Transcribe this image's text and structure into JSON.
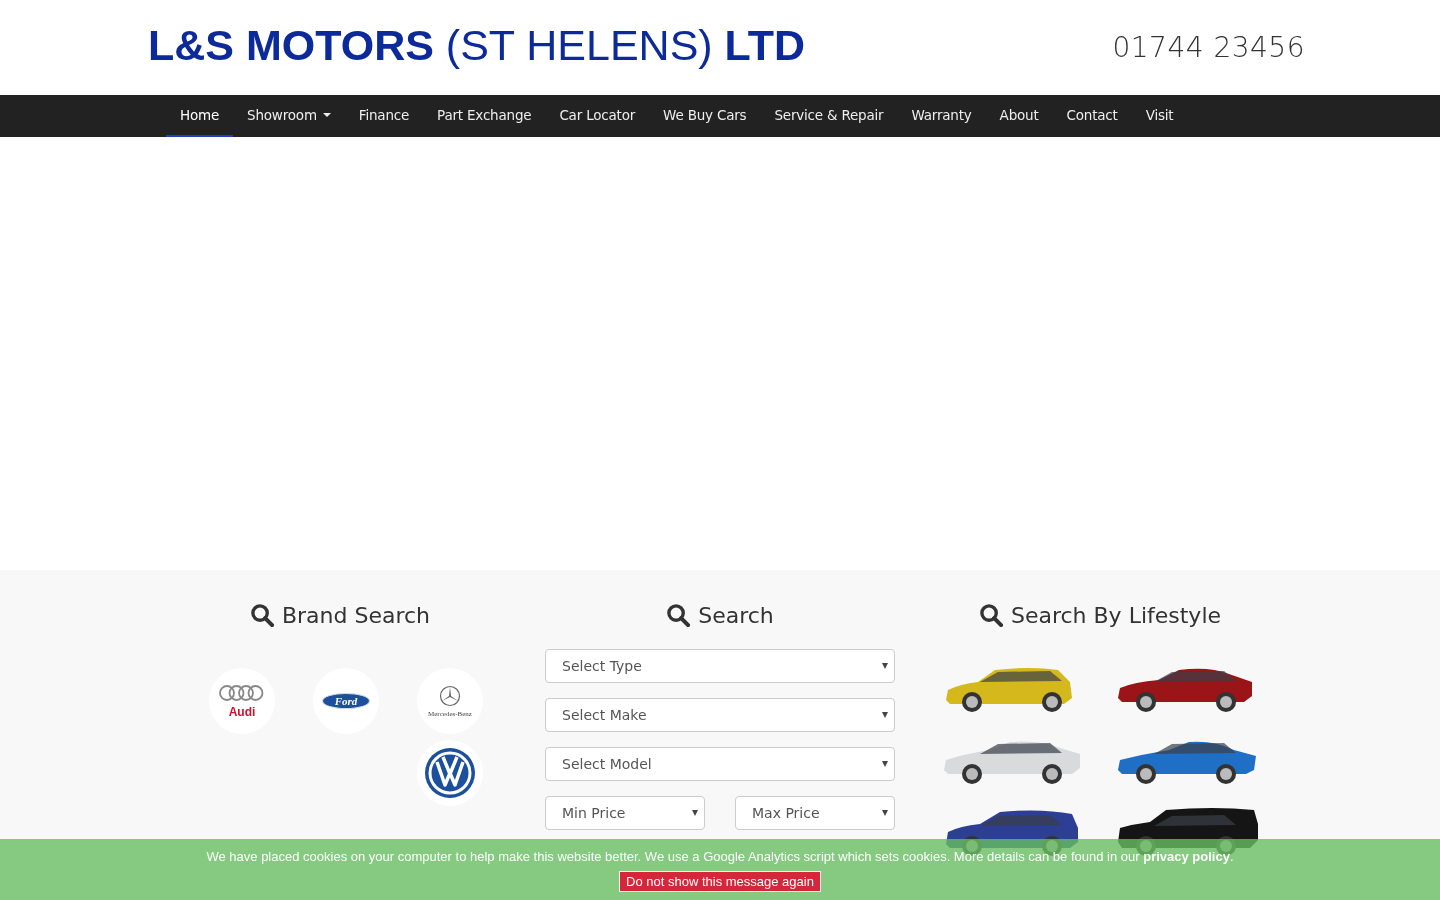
{
  "header": {
    "logo": "**L&S MOTORS** (ST HELENS) **LTD**",
    "phone": "01744 23456"
  },
  "nav": [
    {
      "label": "Home",
      "selected": true,
      "dropdown": false
    },
    {
      "label": "Showroom",
      "selected": false,
      "dropdown": true
    },
    {
      "label": "Finance",
      "selected": false,
      "dropdown": false
    },
    {
      "label": "Part Exchange",
      "selected": false,
      "dropdown": false
    },
    {
      "label": "Car Locator",
      "selected": false,
      "dropdown": false
    },
    {
      "label": "We Buy Cars",
      "selected": false,
      "dropdown": false
    },
    {
      "label": "Service & Repair",
      "selected": false,
      "dropdown": false
    },
    {
      "label": "Warranty",
      "selected": false,
      "dropdown": false
    },
    {
      "label": "About",
      "selected": false,
      "dropdown": false
    },
    {
      "label": "Contact",
      "selected": false,
      "dropdown": false
    },
    {
      "label": "Visit",
      "selected": false,
      "dropdown": false
    }
  ],
  "brand_search": {
    "title": "Brand Search",
    "brands": [
      {
        "kind": "rings",
        "text": "Audi"
      },
      {
        "kind": "oval",
        "text": "Ford"
      },
      {
        "kind": "star",
        "text": "Mercedes-Benz"
      },
      {
        "kind": "vw"
      }
    ]
  },
  "search": {
    "title": "Search",
    "selects": [
      {
        "placeholder": "Select Type"
      },
      {
        "placeholder": "Select Make"
      },
      {
        "placeholder": "Select Model"
      }
    ],
    "price_selects": [
      {
        "placeholder": "Min Price"
      },
      {
        "placeholder": "Max Price"
      }
    ]
  },
  "lifestyle": {
    "title": "Search By Lifestyle",
    "cars": [
      {
        "kind": "hatch",
        "color": "#d4b81c"
      },
      {
        "kind": "saloon",
        "color": "#9a1418"
      },
      {
        "kind": "coupe",
        "color": "#d8dadc"
      },
      {
        "kind": "sports",
        "color": "#1f6fc6"
      },
      {
        "kind": "mpv",
        "color": "#2c3f94"
      },
      {
        "kind": "suv",
        "color": "#151515"
      }
    ]
  },
  "cookie_banner": {
    "message": "We have placed cookies on your computer to help make this website better. We use a Google Analytics script which sets cookies. More details can be found in our ",
    "link": "privacy policy",
    "end": ".",
    "button": "Do not show this message again"
  }
}
